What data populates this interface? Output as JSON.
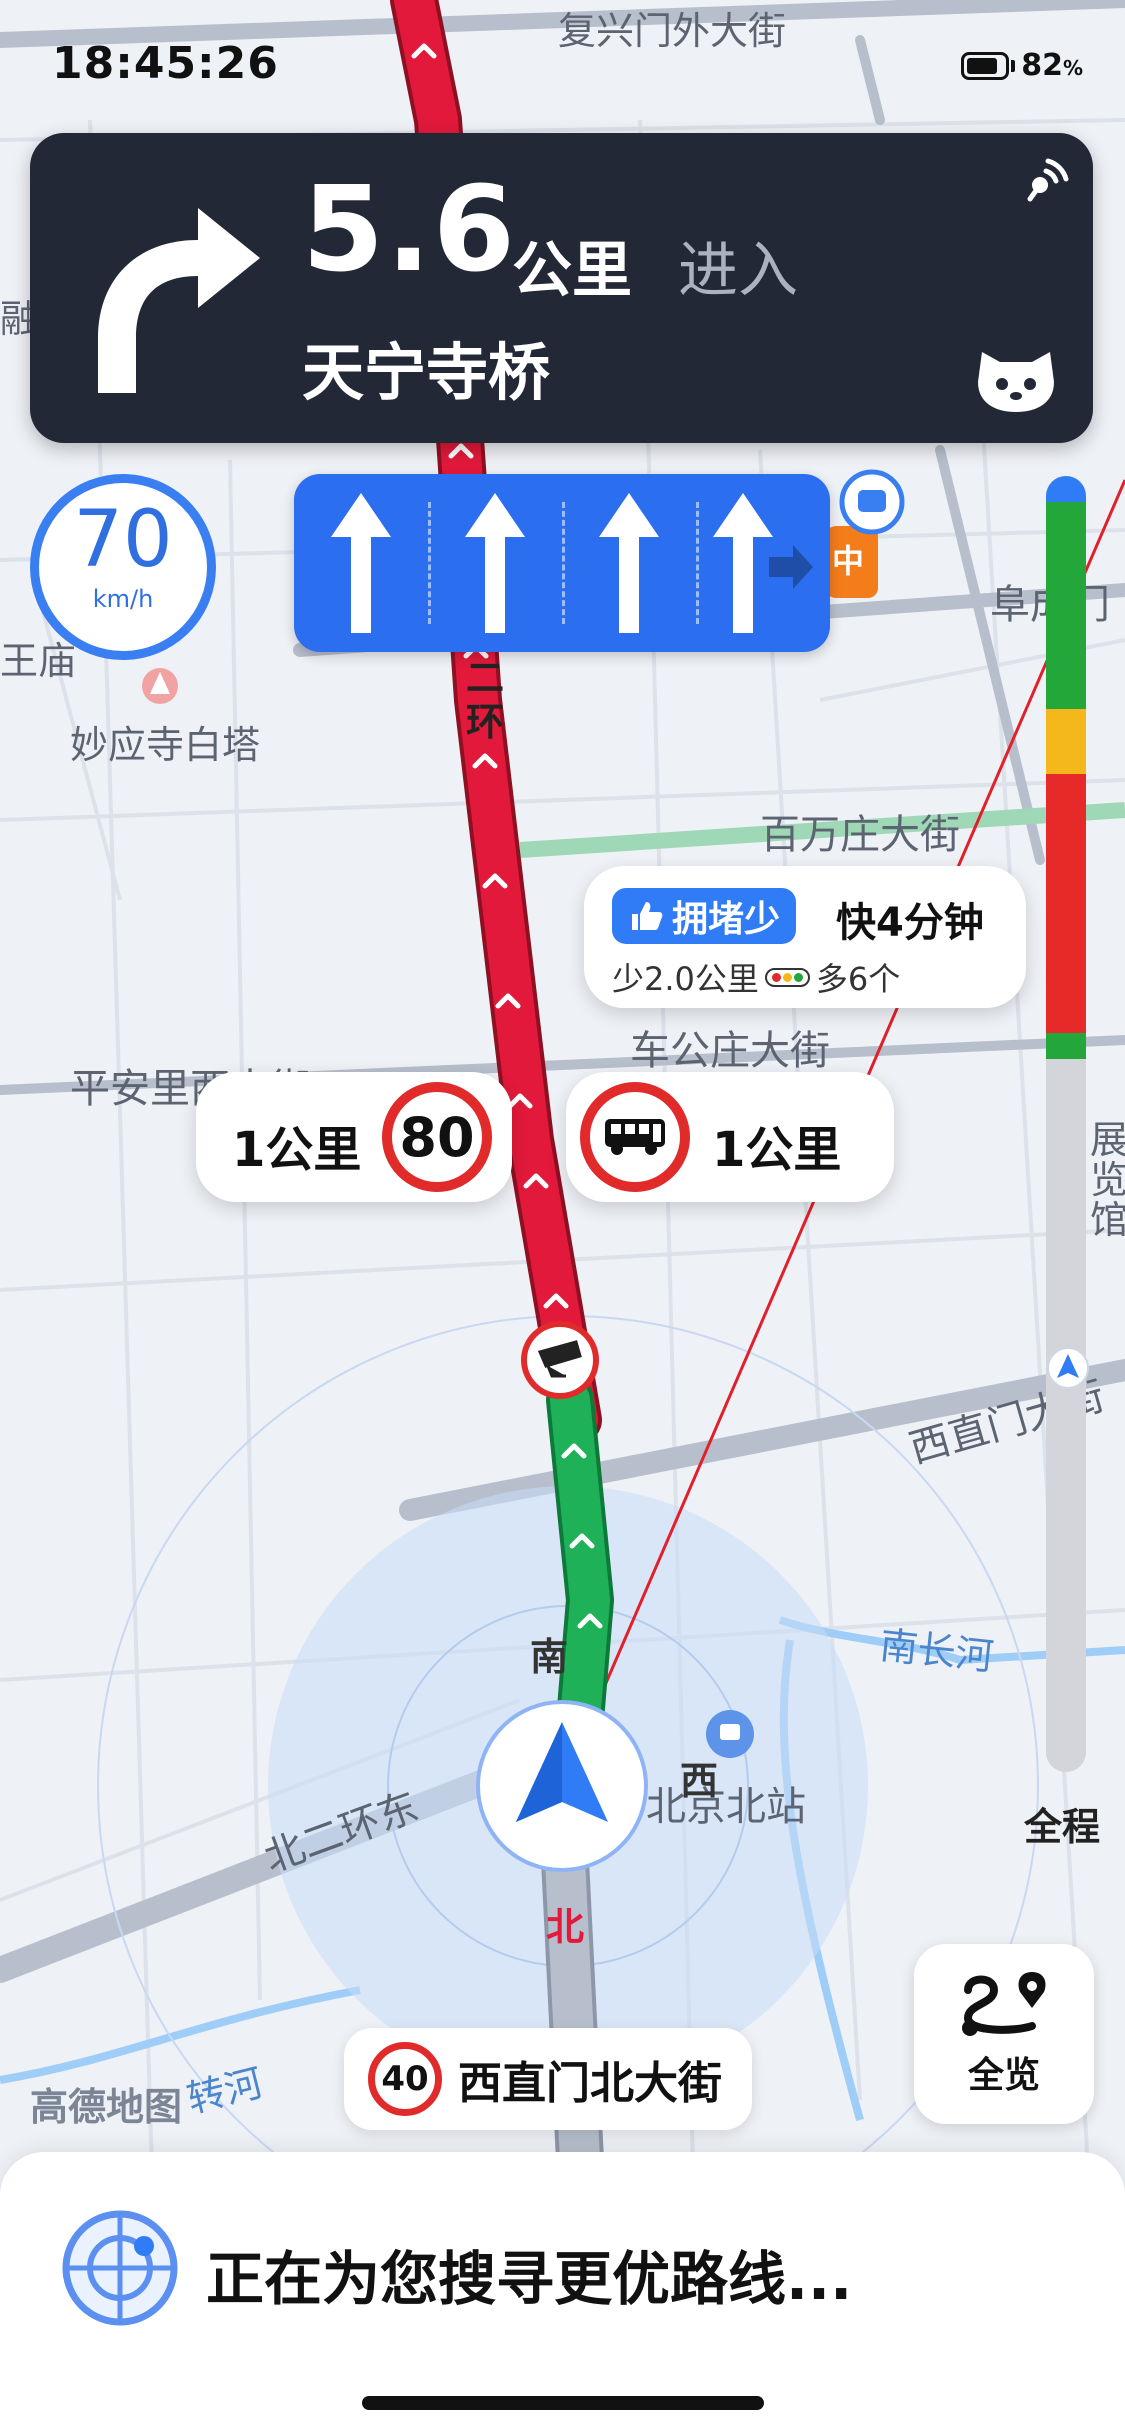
{
  "status_bar": {
    "time": "18:45:26",
    "battery_value": "82",
    "battery_unit": "%"
  },
  "navigation": {
    "distance": "5.6",
    "unit": "公里",
    "action": "进入",
    "road": "天宁寺桥"
  },
  "speed_limit": {
    "value": "70",
    "unit": "km/h"
  },
  "lanes": {
    "count": 4,
    "direction": "straight"
  },
  "map_labels": {
    "fuxingmenwai": "复兴门外大街",
    "miaoyingsi": "妙应寺白塔",
    "baiwanzhuang": "百万庄大街",
    "chegongzhuang": "车公庄大街",
    "pinganli": "平安里西大街",
    "xizhimen": "西直门大街",
    "nanchanghe": "南长河",
    "beijing_north": "北京北站",
    "beierhuan": "北二环东",
    "erhuan": "二环",
    "xi": "西",
    "nan": "南",
    "bei": "北",
    "wangmiao": "王庙",
    "rong": "融",
    "fucheng": "阜成门",
    "zhan": "展览馆",
    "zhuanhe": "转河",
    "zhong": "中"
  },
  "congestion_tip": {
    "tag": "拥堵少",
    "faster": "快4分钟",
    "detail_distance": "少2.0公里",
    "detail_lights": "多6个"
  },
  "cameras": {
    "speed_camera": {
      "distance": "1公里",
      "limit": "80"
    },
    "bus_lane_camera": {
      "distance": "1公里"
    }
  },
  "progress": {
    "end_label": "全程",
    "segments": [
      {
        "color": "#2f7cf6",
        "fraction": 0.02
      },
      {
        "color": "#23a63a",
        "fraction": 0.16
      },
      {
        "color": "#f5b81c",
        "fraction": 0.05
      },
      {
        "color": "#e62a2a",
        "fraction": 0.2
      },
      {
        "color": "#23a63a",
        "fraction": 0.02
      },
      {
        "color": "#d3d5da",
        "fraction": 0.55
      }
    ]
  },
  "overview": {
    "label": "全览"
  },
  "current_road": {
    "limit": "40",
    "name": "西直门北大街"
  },
  "logo": "高德地图",
  "search_status": "正在为您搜寻更优路线...",
  "colors": {
    "nav_card": "#232836",
    "accent": "#2b6ef0",
    "red_route": "#e2193b",
    "green_route": "#1fb158"
  }
}
